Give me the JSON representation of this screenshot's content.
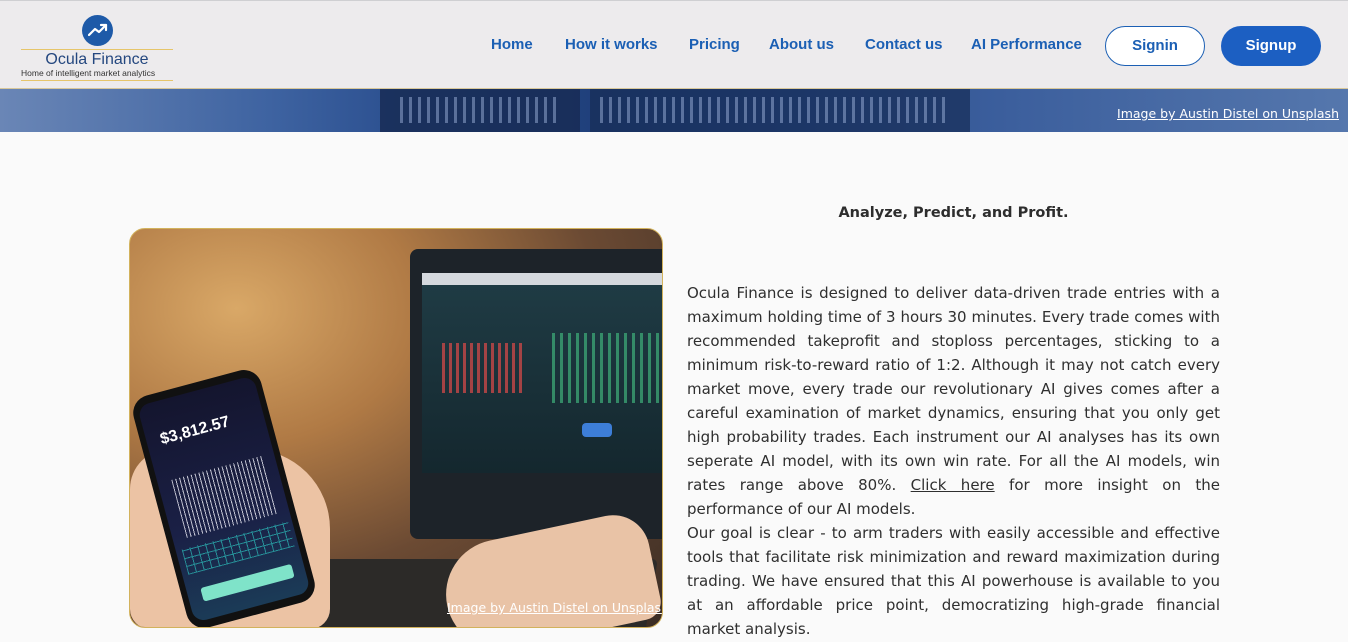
{
  "brand": {
    "name": "Ocula Finance",
    "tagline": "Home of intelligent market analytics"
  },
  "nav": {
    "items": [
      {
        "label": "Home"
      },
      {
        "label": "How it works"
      },
      {
        "label": "Pricing"
      },
      {
        "label": "About us"
      },
      {
        "label": "Contact us"
      },
      {
        "label": "AI Performance"
      }
    ],
    "signin_label": "Signin",
    "signup_label": "Signup"
  },
  "hero": {
    "credit": "Image by Austin Distel on Unsplash"
  },
  "photo": {
    "credit": "Image by Austin Distel on Unsplash",
    "phone_price": "$3,812.57"
  },
  "content": {
    "heading": "Analyze, Predict, and Profit.",
    "p1_before_link": "Ocula Finance is designed to deliver data-driven trade entries with a maximum holding time of 3 hours 30 minutes. Every trade comes with recommended takeprofit and stoploss percentages, sticking to a minimum risk-to-reward ratio of 1:2. Although it may not catch every market move, every trade our revolutionary AI gives comes after a careful examination of market dynamics, ensuring that you only get high probability trades. Each instrument our AI analyses has its own seperate AI model, with its own win rate. For all the AI models, win rates range above 80%. ",
    "p1_link": "Click here",
    "p1_after_link": " for more insight on the performance of our AI models.",
    "p2": "Our goal is clear - to arm traders with easily accessible and effective tools that facilitate risk minimization and reward maximization during trading. We have ensured that this AI powerhouse is available to you at an affordable price point, democratizing high-grade financial market analysis."
  },
  "colors": {
    "brand_blue": "#1b5fb4",
    "signup_bg": "#1c5fc2",
    "header_bg": "#edebed",
    "accent_gold": "#e6c56a"
  }
}
